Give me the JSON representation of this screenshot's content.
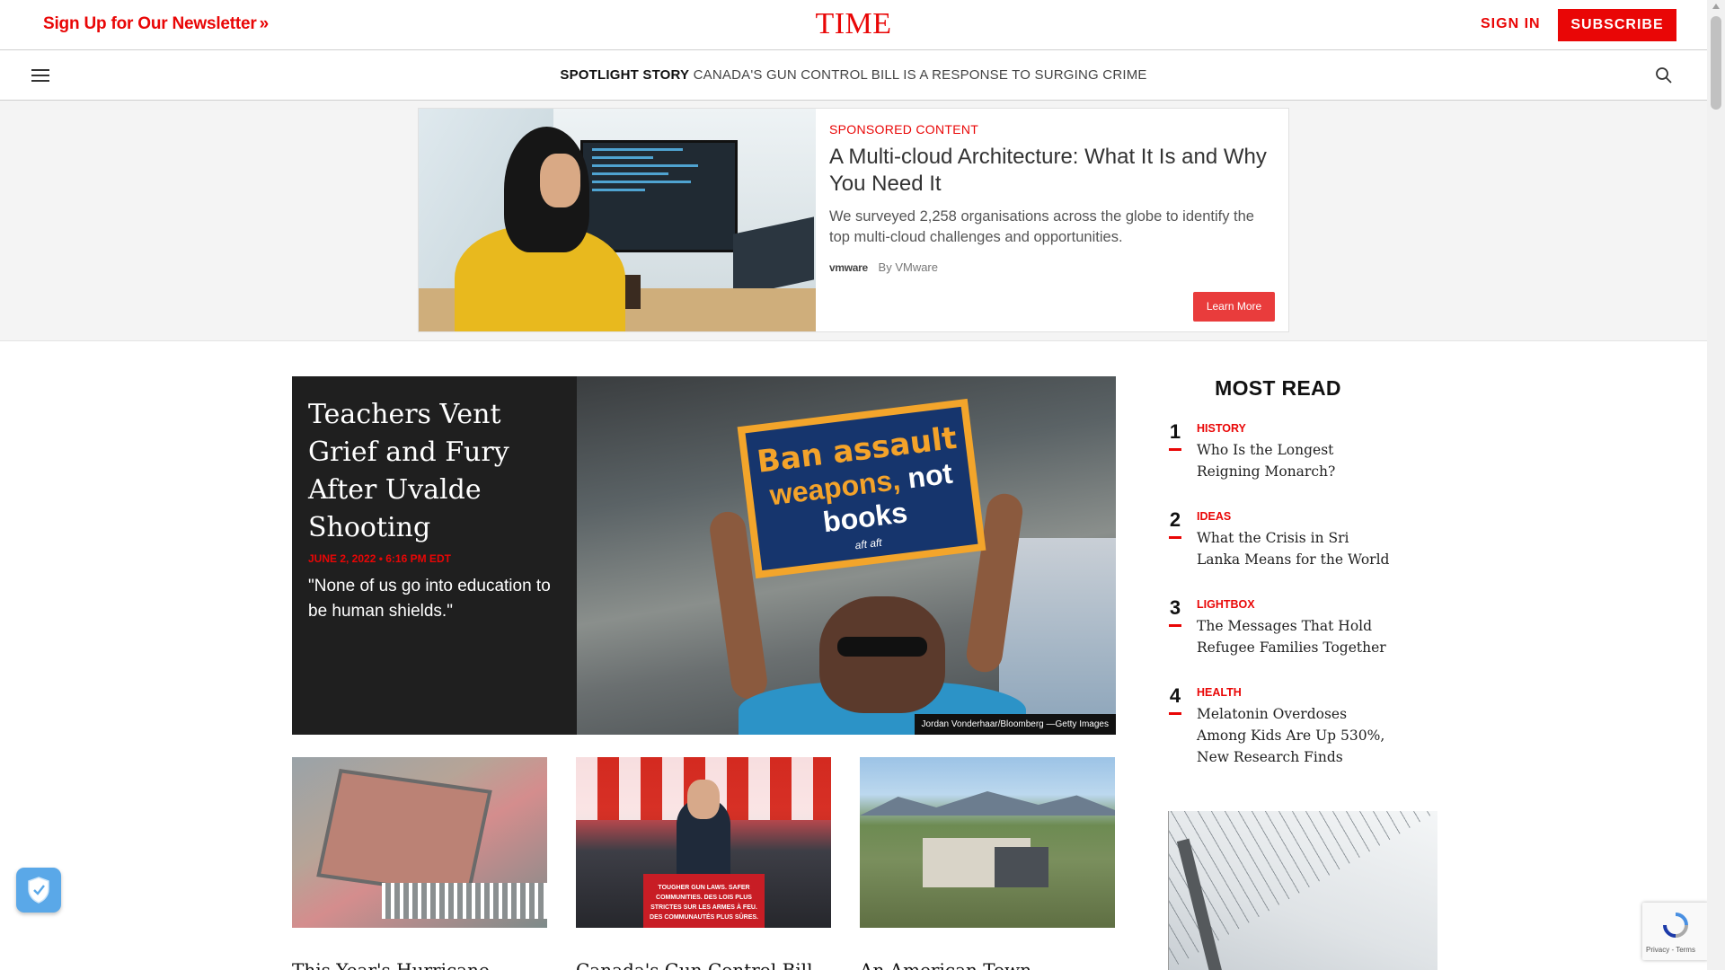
{
  "header": {
    "newsletter_label": "Sign Up for Our Newsletter",
    "newsletter_chevron": "»",
    "logo": "TIME",
    "signin_label": "SIGN IN",
    "subscribe_label": "SUBSCRIBE"
  },
  "spotlight": {
    "label": "SPOTLIGHT STORY",
    "text": "CANADA'S GUN CONTROL BILL IS A RESPONSE TO SURGING CRIME",
    "menu_icon": "hamburger-icon",
    "search_icon": "search-icon"
  },
  "ad": {
    "sponsored_label": "SPONSORED CONTENT",
    "title": "A Multi-cloud Architecture: What It Is and Why You Need It",
    "description": "We surveyed 2,258 organisations across the globe to identify the top multi-cloud challenges and opportunities.",
    "brand_logo": "vmware",
    "by_label": "By VMware",
    "cta_label": "Learn More"
  },
  "hero": {
    "title": "Teachers Vent Grief and Fury After Uvalde Shooting",
    "date": "JUNE 2, 2022 • 6:16 PM EDT",
    "dek": "\"None of us go into education to be human shields.\"",
    "credit": "Jordan Vonderhaar/Bloomberg —Getty Images",
    "sign_line1": "Ban assault",
    "sign_line2a": "weapons, ",
    "sign_line2b": "not",
    "sign_line3": "books",
    "sign_logo": "aft  aft"
  },
  "tiles": [
    {
      "headline": "This Year's Hurricane Season"
    },
    {
      "headline": "Canada's Gun Control Bill Is"
    },
    {
      "headline": "An American Town"
    }
  ],
  "podium_text": "TOUGHER GUN LAWS. SAFER COMMUNITIES. DES LOIS PLUS STRICTES SUR LES ARMES À FEU. DES COMMUNAUTÉS PLUS SÛRES.",
  "most_read": {
    "title": "MOST READ",
    "items": [
      {
        "num": "1",
        "category": "HISTORY",
        "headline": "Who Is the Longest Reigning Monarch?"
      },
      {
        "num": "2",
        "category": "IDEAS",
        "headline": "What the Crisis in Sri Lanka Means for the World"
      },
      {
        "num": "3",
        "category": "LIGHTBOX",
        "headline": "The Messages That Hold Refugee Families Together"
      },
      {
        "num": "4",
        "category": "HEALTH",
        "headline": "Melatonin Overdoses Among Kids Are Up 530%, New Research Finds"
      }
    ]
  },
  "widgets": {
    "shield_icon": "shield-check-icon",
    "recaptcha_text": "Privacy - Terms"
  },
  "colors": {
    "brand_red": "#e90606",
    "hero_bg": "#1f1f1f",
    "ad_bg": "#f4f4f4"
  }
}
